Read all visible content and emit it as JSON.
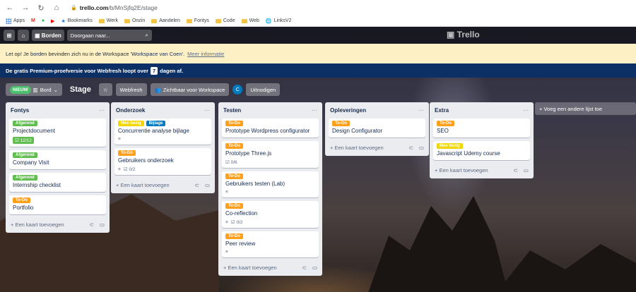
{
  "browser": {
    "url_host": "trello.com",
    "url_path": "/b/MnSjfq2E/stage",
    "bookmarks": [
      "Apps",
      "Bookmarks",
      "Werk",
      "Onzin",
      "Aandelen",
      "Fontys",
      "Code",
      "Web",
      "LinksV2"
    ]
  },
  "header": {
    "boards_label": "Borden",
    "search_placeholder": "Doorgaan naar...",
    "logo": "Trello"
  },
  "banners": {
    "workspace_text": "Let op! Je borden bevinden zich nu in de Workspace 'Workspace van Coen'.",
    "workspace_link": "Meer informatie",
    "trial_text": "De gratis Premium-proefversie voor Webfresh loopt over",
    "trial_days": "7",
    "trial_suffix": "dagen af."
  },
  "board": {
    "new_badge": "NIEUW",
    "view_label": "Bord",
    "title": "Stage",
    "workspace": "Webfresh",
    "visibility": "Zichtbaar voor Workspace",
    "invite": "Uitnodigen",
    "add_list": "+ Voeg een andere lijst toe"
  },
  "add_card_label": "+ Een kaart toevoegen",
  "lists": [
    {
      "title": "Fontys",
      "cards": [
        {
          "labels": [
            {
              "text": "Afgerond",
              "color": "green"
            }
          ],
          "title": "Projectdocument",
          "checklist": "12/12",
          "done": true
        },
        {
          "labels": [
            {
              "text": "Afgerond",
              "color": "green"
            }
          ],
          "title": "Company Visit"
        },
        {
          "labels": [
            {
              "text": "Afgerond",
              "color": "green"
            }
          ],
          "title": "Internship checklist"
        },
        {
          "labels": [
            {
              "text": "To-Do",
              "color": "orange"
            }
          ],
          "title": "Portfolio"
        }
      ]
    },
    {
      "title": "Onderzoek",
      "cards": [
        {
          "labels": [
            {
              "text": "Mee bezig",
              "color": "yellow"
            },
            {
              "text": "Bijlage",
              "color": "blue"
            }
          ],
          "title": "Concurrentie analyse bijlage",
          "desc": true
        },
        {
          "labels": [
            {
              "text": "To-Do",
              "color": "orange"
            }
          ],
          "title": "Gebruikers onderzoek",
          "desc": true,
          "checklist": "0/2"
        }
      ]
    },
    {
      "title": "Testen",
      "cards": [
        {
          "labels": [
            {
              "text": "To-Do",
              "color": "orange"
            }
          ],
          "title": "Prototype Wordpress configurator"
        },
        {
          "labels": [
            {
              "text": "To-Do",
              "color": "orange"
            }
          ],
          "title": "Prototype Three.js",
          "checklist": "0/6"
        },
        {
          "labels": [
            {
              "text": "To-Do",
              "color": "orange"
            }
          ],
          "title": "Gebruikers testen (Lab)",
          "desc": true
        },
        {
          "labels": [
            {
              "text": "To-Do",
              "color": "orange"
            }
          ],
          "title": "Co-reflection",
          "desc": true,
          "checklist": "0/2"
        },
        {
          "labels": [
            {
              "text": "To-Do",
              "color": "orange"
            }
          ],
          "title": "Peer review",
          "desc": true
        }
      ]
    },
    {
      "title": "Opleveringen",
      "cards": [
        {
          "labels": [
            {
              "text": "To-Do",
              "color": "orange"
            }
          ],
          "title": "Design Configurator"
        }
      ]
    },
    {
      "title": "Extra",
      "cards": [
        {
          "labels": [
            {
              "text": "To-Do",
              "color": "orange"
            }
          ],
          "title": "SEO"
        },
        {
          "labels": [
            {
              "text": "Mee bezig",
              "color": "yellow"
            }
          ],
          "title": "Javascript Udemy course"
        }
      ]
    }
  ]
}
